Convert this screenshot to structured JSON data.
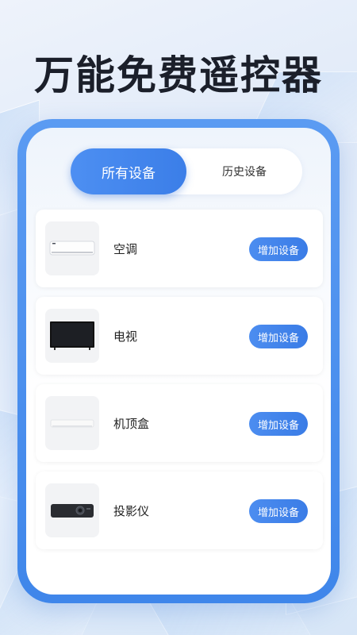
{
  "headline": "万能免费遥控器",
  "tabs": [
    {
      "label": "所有设备",
      "active": true
    },
    {
      "label": "历史设备",
      "active": false
    }
  ],
  "devices": [
    {
      "name": "空调",
      "button": "增加设备",
      "icon": "air-conditioner-icon"
    },
    {
      "name": "电视",
      "button": "增加设备",
      "icon": "tv-icon"
    },
    {
      "name": "机顶盒",
      "button": "增加设备",
      "icon": "set-top-box-icon"
    },
    {
      "name": "投影仪",
      "button": "增加设备",
      "icon": "projector-icon"
    }
  ],
  "colors": {
    "accent": "#3f86ea",
    "headline": "#1b1f2a"
  }
}
